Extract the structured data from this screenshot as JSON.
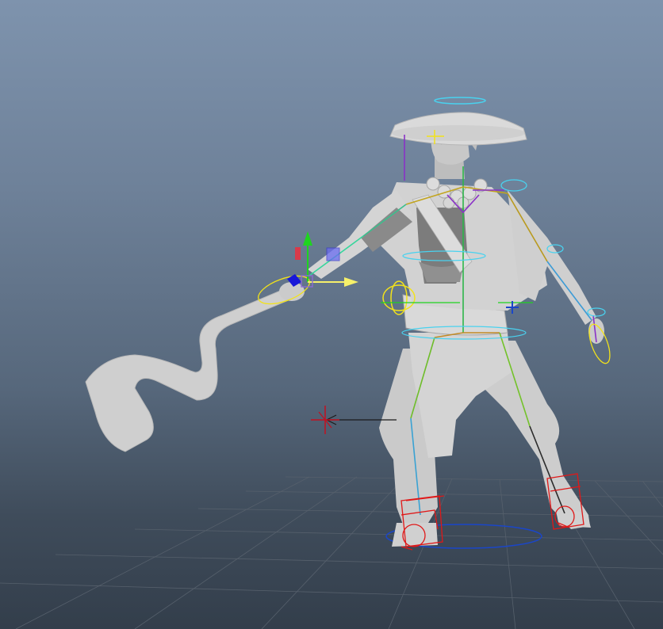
{
  "viewport": {
    "background_top": "#7e93ad",
    "background_bottom": "#333e4b",
    "grid_color": "#56606c",
    "mesh_color": "#cfcfcf",
    "mesh_shadow_color": "#8f8f8f"
  },
  "rig": {
    "ik_foot_color": "#e01818",
    "cog_color": "#f2e21a",
    "root_ring_color": "#1a46c9",
    "head_ring_color": "#49d2ef",
    "pole_vector_color": "#c21020"
  },
  "manipulator": {
    "x_axis_color": "#f6f06a",
    "y_axis_color": "#1fd41f",
    "z_axis_color": "#d83a4a",
    "plane_color": "#6a6cf0",
    "center_color": "#1818d8"
  },
  "icons": [
    "move-manipulator-icon",
    "locator-icon"
  ]
}
